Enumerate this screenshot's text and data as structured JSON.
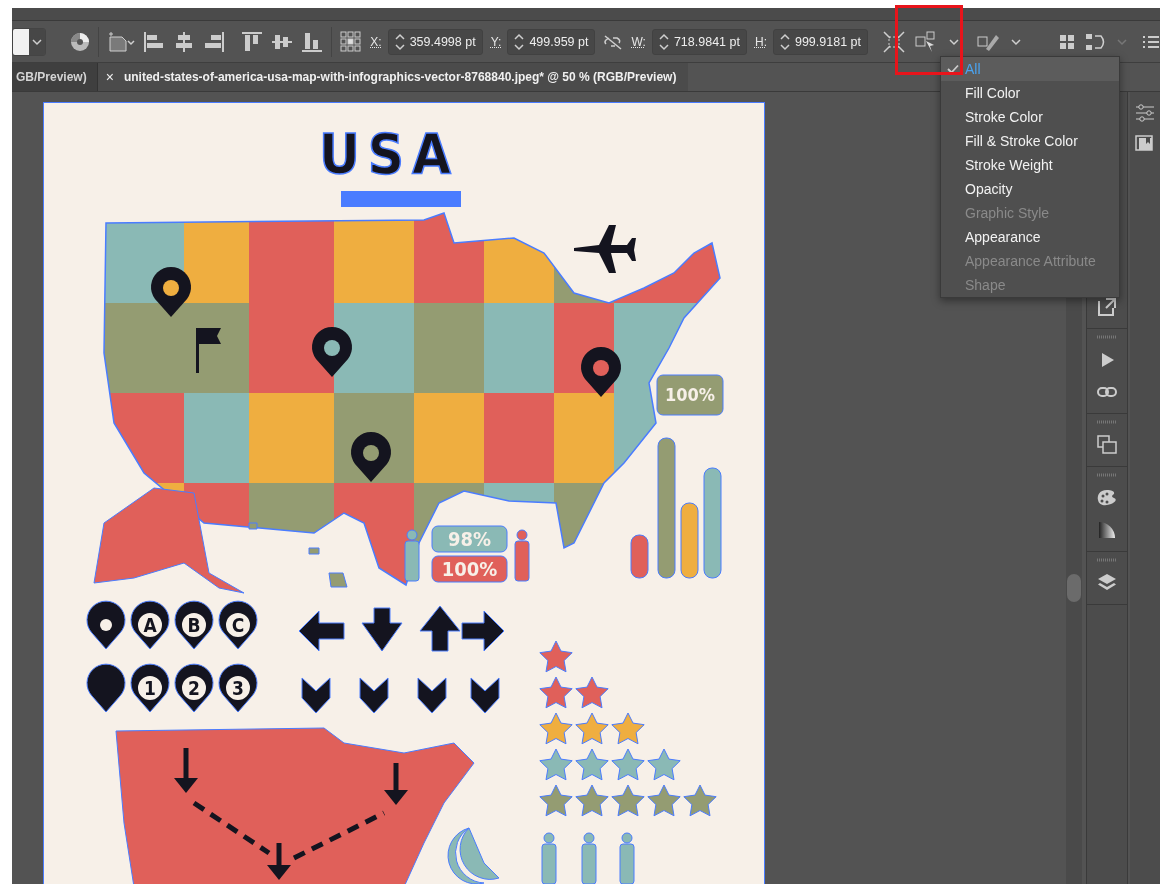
{
  "control_bar": {
    "fields": [
      {
        "label": "X:",
        "value": "359.4998 pt"
      },
      {
        "label": "Y:",
        "value": "499.959 pt"
      },
      {
        "label": "W:",
        "value": "718.9841 pt"
      },
      {
        "label": "H:",
        "value": "999.9181 pt"
      }
    ]
  },
  "tabs": [
    {
      "label": "GB/Preview)",
      "selected": false
    },
    {
      "label": "united-states-of-america-usa-map-with-infographics-vector-8768840.jpeg* @ 50 % (RGB/Preview)",
      "selected": true,
      "close": "×"
    }
  ],
  "menu": {
    "items": [
      {
        "label": "All",
        "selected": true,
        "disabled": false
      },
      {
        "label": "Fill Color",
        "selected": false,
        "disabled": false
      },
      {
        "label": "Stroke Color",
        "selected": false,
        "disabled": false
      },
      {
        "label": "Fill & Stroke Color",
        "selected": false,
        "disabled": false
      },
      {
        "label": "Stroke Weight",
        "selected": false,
        "disabled": false
      },
      {
        "label": "Opacity",
        "selected": false,
        "disabled": false
      },
      {
        "label": "Graphic Style",
        "selected": false,
        "disabled": true
      },
      {
        "label": "Appearance",
        "selected": false,
        "disabled": false
      },
      {
        "label": "Appearance Attribute",
        "selected": false,
        "disabled": true
      },
      {
        "label": "Shape",
        "selected": false,
        "disabled": true
      }
    ]
  },
  "artboard": {
    "title": "USA",
    "stats": [
      {
        "label": "100%",
        "color": "#949c72"
      },
      {
        "label": "98%",
        "color": "#8ab9b5"
      },
      {
        "label": "100%",
        "color": "#e0605a"
      }
    ],
    "markers": [
      {
        "kind": "dot"
      },
      {
        "kind": "letter",
        "label": "A"
      },
      {
        "kind": "letter",
        "label": "B"
      },
      {
        "kind": "letter",
        "label": "C"
      },
      {
        "kind": "filled"
      },
      {
        "kind": "letter",
        "label": "1"
      },
      {
        "kind": "letter",
        "label": "2"
      },
      {
        "kind": "letter",
        "label": "3"
      }
    ]
  }
}
